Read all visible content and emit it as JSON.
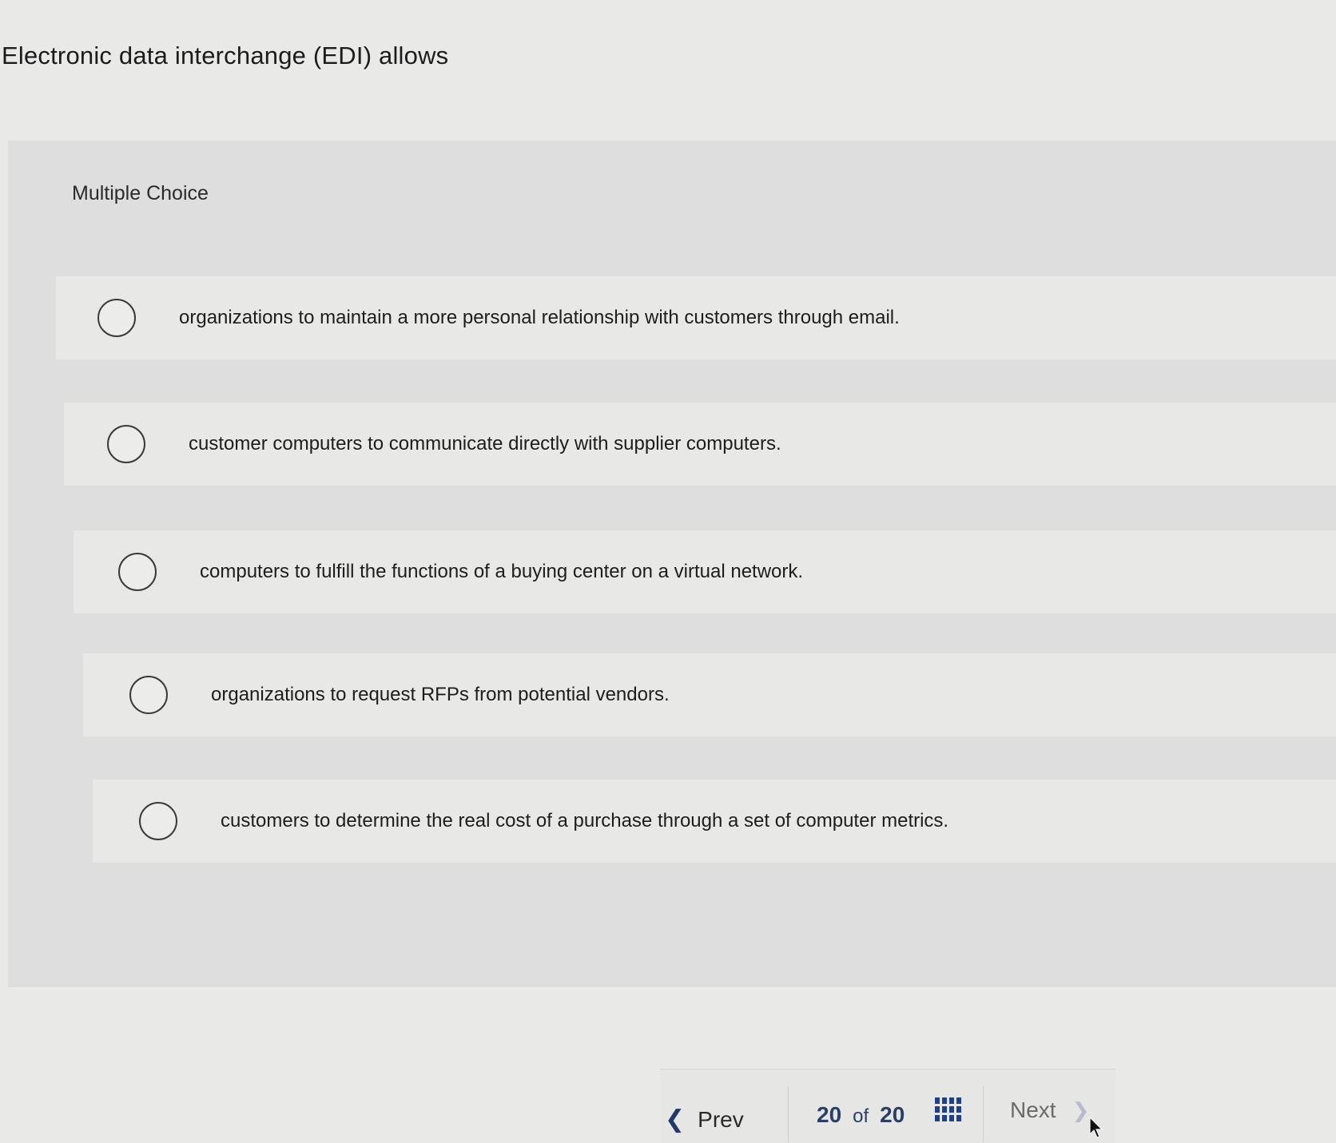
{
  "question": {
    "stem": "Electronic data interchange (EDI) allows",
    "type_label": "Multiple Choice"
  },
  "choices": [
    {
      "label": "organizations to maintain a more personal relationship with customers through email."
    },
    {
      "label": "customer computers to communicate directly with supplier computers."
    },
    {
      "label": "computers to fulfill the functions of a buying center on a virtual network."
    },
    {
      "label": "organizations to request RFPs from potential vendors."
    },
    {
      "label": "customers to determine the real cost of a purchase through a set of computer metrics."
    }
  ],
  "navigation": {
    "prev_label": "Prev",
    "current_page": "20",
    "of_label": "of",
    "total_pages": "20",
    "next_label": "Next",
    "prev_icon": "chevron-left-icon",
    "next_icon": "chevron-right-icon",
    "grid_icon": "grid-icon"
  },
  "colors": {
    "accent": "#1f3f8a",
    "page_background": "#e9e9e8",
    "panel_background": "#dedede"
  }
}
